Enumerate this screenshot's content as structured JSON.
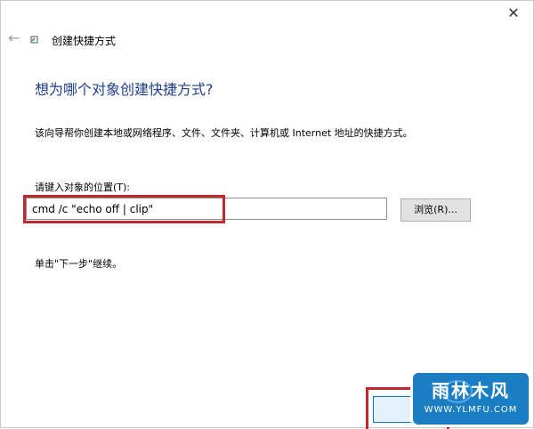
{
  "window": {
    "close_glyph": "✕",
    "back_glyph": "←",
    "title": "创建快捷方式"
  },
  "main": {
    "heading": "想为哪个对象创建快捷方式?",
    "description": "该向导帮你创建本地或网络程序、文件、文件夹、计算机或 Internet 地址的快捷方式。",
    "field_label": "请键入对象的位置(T):",
    "location_value": "cmd /c \"echo off | clip\"",
    "browse_label": "浏览(R)...",
    "instruction": "单击\"下一步\"继续。"
  },
  "watermark": {
    "top": "雨林木风",
    "bottom": "WWW.YLMFU.COM"
  },
  "colors": {
    "heading": "#1f3f91",
    "highlight": "#c1272d",
    "watermark_bg": "#1b7ec2"
  }
}
